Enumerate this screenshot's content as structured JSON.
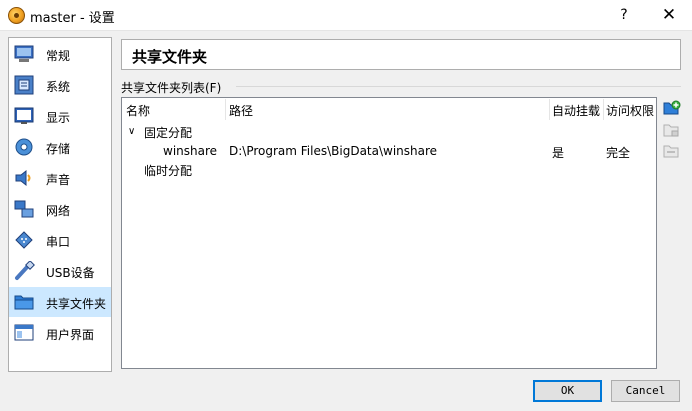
{
  "window": {
    "title": "master - 设置",
    "help_label": "?",
    "close_label": "✕"
  },
  "sidebar": {
    "items": [
      {
        "label": "常规",
        "icon": "general-icon"
      },
      {
        "label": "系统",
        "icon": "system-icon"
      },
      {
        "label": "显示",
        "icon": "display-icon"
      },
      {
        "label": "存储",
        "icon": "storage-icon"
      },
      {
        "label": "声音",
        "icon": "audio-icon"
      },
      {
        "label": "网络",
        "icon": "network-icon"
      },
      {
        "label": "串口",
        "icon": "serial-port-icon"
      },
      {
        "label": "USB设备",
        "icon": "usb-icon"
      },
      {
        "label": "共享文件夹",
        "icon": "shared-folder-icon",
        "selected": true
      },
      {
        "label": "用户界面",
        "icon": "user-interface-icon"
      }
    ]
  },
  "page": {
    "title": "共享文件夹",
    "group_label": "共享文件夹列表(F)"
  },
  "table": {
    "columns": [
      "名称",
      "路径",
      "自动挂载",
      "访问权限"
    ],
    "groups": [
      {
        "label": "固定分配",
        "expanded": true,
        "rows": [
          {
            "name": "winshare",
            "path": "D:\\Program Files\\BigData\\winshare",
            "automount": "是",
            "access": "完全"
          }
        ]
      },
      {
        "label": "临时分配",
        "rows": []
      }
    ]
  },
  "toolbar": {
    "add_icon": "add-shared-folder-icon",
    "edit_icon": "edit-shared-folder-icon",
    "remove_icon": "remove-shared-folder-icon"
  },
  "buttons": {
    "ok_label": "OK",
    "cancel_label": "Cancel"
  },
  "colors": {
    "selected_bg": "#cce8ff",
    "default_button_border": "#0078d7"
  }
}
